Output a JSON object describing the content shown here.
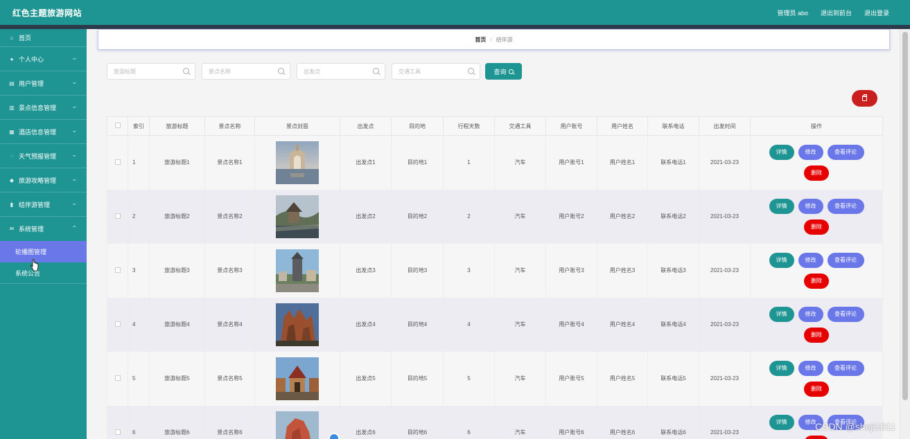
{
  "app": {
    "title": "红色主题旅游网站",
    "user_label": "管理员 abo",
    "front_link": "退出到前台",
    "logout_link": "退出登录"
  },
  "sidebar": {
    "items": [
      {
        "label": "首页",
        "icon": "home-icon"
      },
      {
        "label": "个人中心",
        "icon": "user-icon"
      },
      {
        "label": "用户管理",
        "icon": "users-icon"
      },
      {
        "label": "景点信息管理",
        "icon": "scenic-icon"
      },
      {
        "label": "酒店信息管理",
        "icon": "hotel-icon"
      },
      {
        "label": "天气预报管理",
        "icon": "weather-icon"
      },
      {
        "label": "旅游攻略管理",
        "icon": "guide-icon"
      },
      {
        "label": "结伴游管理",
        "icon": "companion-icon"
      },
      {
        "label": "系统管理",
        "icon": "system-icon"
      }
    ],
    "sub_items": [
      "轮播图管理",
      "系统公告"
    ]
  },
  "breadcrumb": {
    "home": "首页",
    "sep": "/",
    "current": "结伴游"
  },
  "search": {
    "placeholders": [
      "旅游标题",
      "景点名称",
      "出发点",
      "交通工具"
    ],
    "button": "查询"
  },
  "table": {
    "headers": [
      "索引",
      "旅游标题",
      "景点名称",
      "景点封面",
      "出发点",
      "目的地",
      "行程天数",
      "交通工具",
      "用户账号",
      "用户姓名",
      "联系电话",
      "出发时间",
      "操作"
    ],
    "rows": [
      {
        "idx": "1",
        "title": "旅游标题1",
        "scenic": "景点名称1",
        "from": "出发点1",
        "to": "目的地1",
        "days": "1",
        "vehicle": "汽车",
        "account": "用户账号1",
        "name": "用户姓名1",
        "phone": "联系电话1",
        "date": "2021-03-23"
      },
      {
        "idx": "2",
        "title": "旅游标题2",
        "scenic": "景点名称2",
        "from": "出发点2",
        "to": "目的地2",
        "days": "2",
        "vehicle": "汽车",
        "account": "用户账号2",
        "name": "用户姓名2",
        "phone": "联系电话2",
        "date": "2021-03-23"
      },
      {
        "idx": "3",
        "title": "旅游标题3",
        "scenic": "景点名称3",
        "from": "出发点3",
        "to": "目的地3",
        "days": "3",
        "vehicle": "汽车",
        "account": "用户账号3",
        "name": "用户姓名3",
        "phone": "联系电话3",
        "date": "2021-03-23"
      },
      {
        "idx": "4",
        "title": "旅游标题4",
        "scenic": "景点名称4",
        "from": "出发点4",
        "to": "目的地4",
        "days": "4",
        "vehicle": "汽车",
        "account": "用户账号4",
        "name": "用户姓名4",
        "phone": "联系电话4",
        "date": "2021-03-23"
      },
      {
        "idx": "5",
        "title": "旅游标题5",
        "scenic": "景点名称5",
        "from": "出发点5",
        "to": "目的地5",
        "days": "5",
        "vehicle": "汽车",
        "account": "用户账号5",
        "name": "用户姓名5",
        "phone": "联系电话5",
        "date": "2021-03-23"
      },
      {
        "idx": "6",
        "title": "旅游标题6",
        "scenic": "景点名称6",
        "from": "出发点6",
        "to": "目的地6",
        "days": "6",
        "vehicle": "汽车",
        "account": "用户账号6",
        "name": "用户姓名6",
        "phone": "联系电话6",
        "date": "2021-03-23"
      }
    ],
    "actions": {
      "detail": "详情",
      "edit": "修改",
      "comment": "查看评论",
      "delete": "删除"
    }
  },
  "watermark": "CSDN @sheji1011",
  "colors": {
    "primary": "#1f9593",
    "accent": "#6a77e8",
    "danger": "#e60000",
    "topstripe": "#2d3a4b"
  }
}
